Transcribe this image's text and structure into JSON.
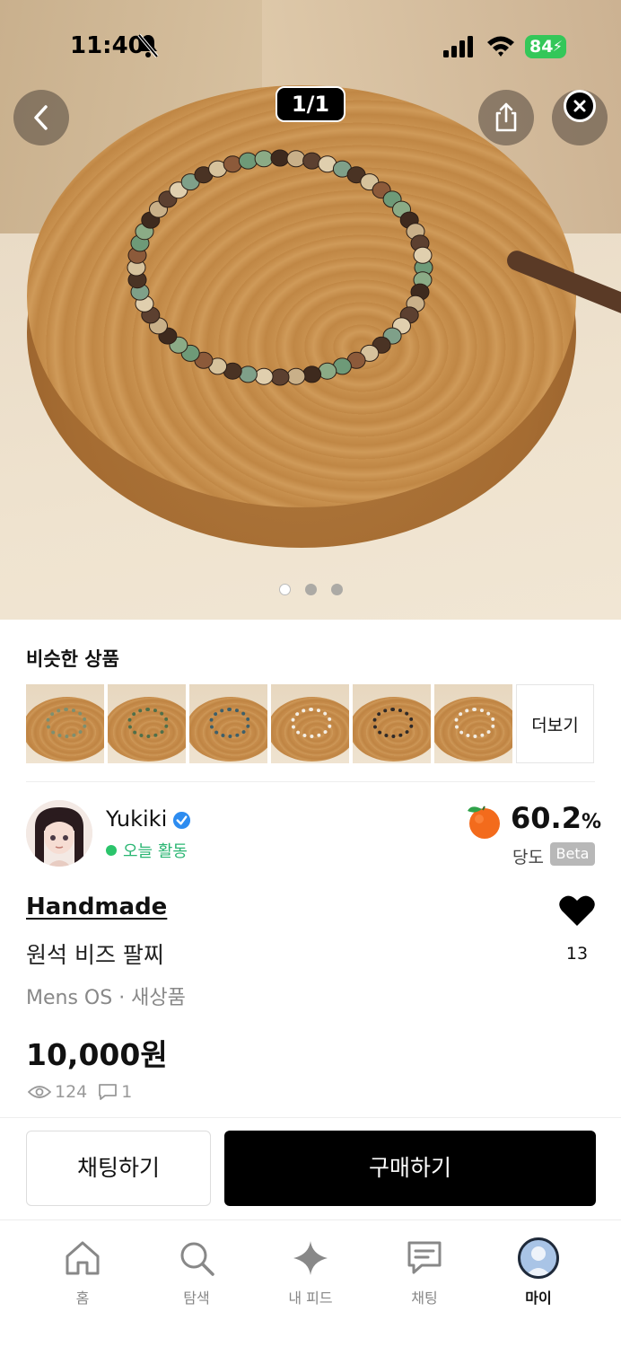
{
  "status_bar": {
    "time": "11:40",
    "battery": "84"
  },
  "gallery": {
    "counter": "1/1",
    "dots": 3,
    "active_dot": 0
  },
  "similar": {
    "title": "비슷한 상품",
    "more_label": "더보기",
    "thumbnails": 6
  },
  "seller": {
    "name": "Yukiki",
    "activity": "오늘 활동",
    "score_value": "60.2",
    "score_unit": "%",
    "score_label": "당도",
    "beta_label": "Beta"
  },
  "product": {
    "brand": "Handmade",
    "name": "원석 비즈 팔찌",
    "meta": "Mens OS · 새상품",
    "price": "10,000원",
    "views": "124",
    "comments": "1",
    "likes": "13"
  },
  "actions": {
    "chat_label": "채팅하기",
    "buy_label": "구매하기"
  },
  "tabbar": {
    "items": [
      {
        "label": "홈",
        "icon": "home-icon"
      },
      {
        "label": "탐색",
        "icon": "search-icon"
      },
      {
        "label": "내 피드",
        "icon": "sparkle-icon"
      },
      {
        "label": "채팅",
        "icon": "chat-icon"
      },
      {
        "label": "마이",
        "icon": "profile-icon"
      }
    ],
    "active_index": 4
  },
  "colors": {
    "active_green": "#2bc46b",
    "verified_blue": "#2d8cf0",
    "battery_green": "#34c759"
  }
}
